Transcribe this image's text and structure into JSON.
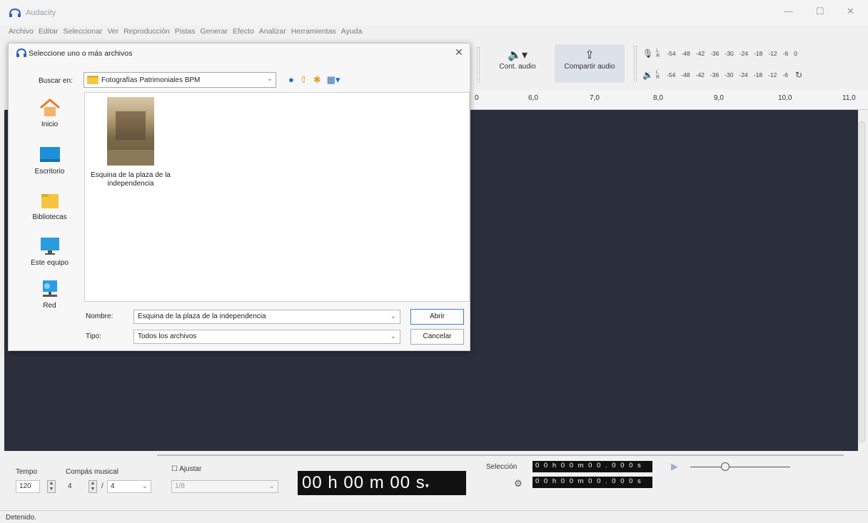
{
  "app": {
    "title": "Audacity",
    "menu": [
      "Archivo",
      "Editar",
      "Seleccionar",
      "Ver",
      "Reproducción",
      "Pistas",
      "Generar",
      "Efecto",
      "Analizar",
      "Herramientas",
      "Ayuda"
    ]
  },
  "window_controls": {
    "minimize": "—",
    "maximize": "☐",
    "close": "✕"
  },
  "toolbar": {
    "audio_setup_label": "Cont. audio",
    "share_audio_label": "Compartir audio",
    "audio_setup_icon": "speaker-icon",
    "share_icon": "share-upload-icon",
    "record_meter_scale": [
      "-54",
      "-48",
      "-42",
      "-36",
      "-30",
      "-24",
      "-18",
      "-12",
      "-6",
      "0"
    ],
    "play_meter_scale": [
      "-54",
      "-48",
      "-42",
      "-36",
      "-30",
      "-24",
      "-18",
      "-12",
      "-6"
    ]
  },
  "ruler": {
    "ticks": [
      "0",
      "6,0",
      "7,0",
      "8,0",
      "9,0",
      "10,0",
      "11,0"
    ]
  },
  "dialog": {
    "title": "Seleccione uno o más archivos",
    "look_in_label": "Buscar en:",
    "look_in_value": "Fotografías Patrimoniales BPM",
    "places": [
      "Inicio",
      "Escritorio",
      "Bibliotecas",
      "Este equipo",
      "Red"
    ],
    "files": [
      {
        "name": "Esquina de la plaza de la independencia"
      }
    ],
    "filename_label": "Nombre:",
    "filename_value": "Esquina de la plaza de la independencia",
    "filetype_label": "Tipo:",
    "filetype_value": "Todos los archivos",
    "open_button": "Abrir",
    "cancel_button": "Cancelar",
    "close_glyph": "✕"
  },
  "bottom": {
    "tempo_label": "Tempo",
    "tempo_value": "120",
    "time_signature_label": "Compás musical",
    "ts_numerator": "4",
    "ts_separator": "/",
    "ts_denominator": "4",
    "snap_label": "Ajustar",
    "snap_value": "1/8",
    "timer_value": "00 h 00 m 00 s",
    "selection_label": "Selección",
    "selection_start": "0 0 h 0 0 m 0 0 . 0 0 0 s",
    "selection_end": "0 0 h 0 0 m 0 0 . 0 0 0 s"
  },
  "status": {
    "text": "Detenido."
  },
  "colors": {
    "track_bg": "#2b2f3b",
    "accent": "#3b7ed8",
    "timer_bg": "#111111"
  }
}
